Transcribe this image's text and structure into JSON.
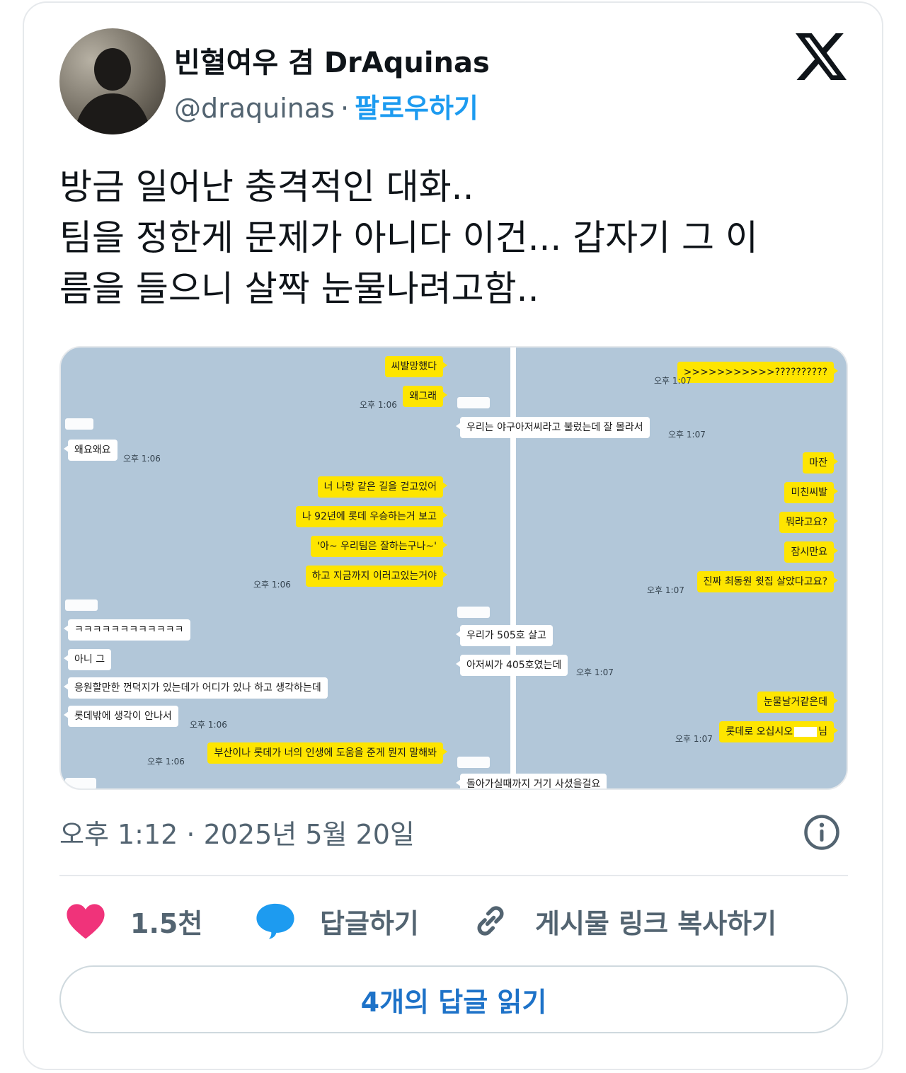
{
  "author": {
    "display_name": "빈혈여우 겸 DrAquinas",
    "handle": "@draquinas",
    "separator": "·",
    "follow_label": "팔로우하기"
  },
  "tweet": {
    "lines": [
      "방금 일어난 충격적인 대화..",
      "팀을 정한게 문제가 아니다 이건... 갑자기 그 이",
      "름을 들으니 살짝 눈물나려고함.."
    ],
    "timestamp": "오후 1:12 · 2025년 5월 20일"
  },
  "chat_left": {
    "m1": "씨발망했다",
    "m2": "왜그래",
    "t1": "오후 1:06",
    "m3": "왜요왜요",
    "t2": "오후 1:06",
    "m4": "너 나랑 같은 길을 걷고있어",
    "m5": "나 92년에 롯데 우승하는거 보고",
    "m6": "'아~ 우리팀은 잘하는구나~'",
    "m7": "하고 지금까지 이러고있는거야",
    "t3": "오후 1:06",
    "m8": "ㅋㅋㅋㅋㅋㅋㅋㅋㅋㅋㅋㅋ",
    "m9": "아니 그",
    "m10": "응원할만한 껀덕지가 있는데가 어디가 있나 하고 생각하는데",
    "m11": "롯데밖에 생각이 안나서",
    "t4": "오후 1:06",
    "m12": "부산이나 롯데가 너의 인생에 도움을 준게 뭔지 말해봐",
    "t5": "오후 1:06"
  },
  "chat_right": {
    "m1": ">>>>>>>>>>>??????????",
    "t1": "오후 1:07",
    "m2": "우리는 야구아저씨라고 불렀는데 잘 몰라서",
    "t2": "오후 1:07",
    "m3": "마잔",
    "m4": "미친씨발",
    "m5": "뭐라고요?",
    "m6": "잠시만요",
    "m7": "진짜 최동원 윗집 살았다고요?",
    "t3": "오후 1:07",
    "m8": "우리가 505호 살고",
    "m9": "아저씨가 405호였는데",
    "t4": "오후 1:07",
    "m10": "눈물날거같은데",
    "m11": "롯데로 오십시오",
    "m11_suffix": "님",
    "t5": "오후 1:07",
    "m12": "돌아가실때까지 거기 사셨을걸요"
  },
  "actions": {
    "like_count": "1.5천",
    "reply_label": "답글하기",
    "copy_link_label": "게시물 링크 복사하기",
    "read_replies_label": "4개의 답글 읽기"
  },
  "colors": {
    "like": "#f0337a",
    "reply": "#1d9bf0",
    "link": "#536471",
    "chat_bg": "#b2c7d9",
    "my_bubble": "#fee500"
  },
  "icons": [
    "x-logo-icon",
    "info-icon",
    "heart-icon",
    "speech-bubble-icon",
    "link-icon"
  ]
}
